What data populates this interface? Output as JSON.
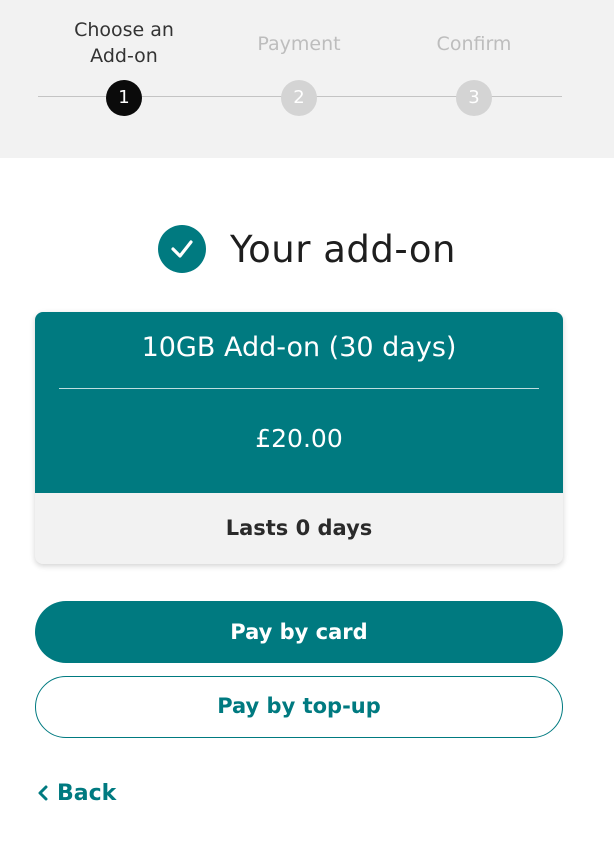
{
  "stepper": {
    "steps": [
      {
        "number": "1",
        "label": "Choose an\nAdd-on",
        "state": "active"
      },
      {
        "number": "2",
        "label": "Payment",
        "state": "inactive"
      },
      {
        "number": "3",
        "label": "Confirm",
        "state": "inactive"
      }
    ]
  },
  "heading": {
    "title": "Your add-on",
    "icon": "check-circle-icon"
  },
  "addon_card": {
    "name": "10GB Add-on (30 days)",
    "price": "£20.00",
    "duration": "Lasts 0 days"
  },
  "actions": {
    "pay_card_label": "Pay by card",
    "pay_topup_label": "Pay by top-up",
    "back_label": "Back",
    "back_icon": "chevron-left-icon"
  },
  "colors": {
    "brand_teal": "#007a80",
    "active_step": "#0b0b0b",
    "inactive_step": "#d4d4d4",
    "stepper_bg": "#f2f2f2"
  }
}
